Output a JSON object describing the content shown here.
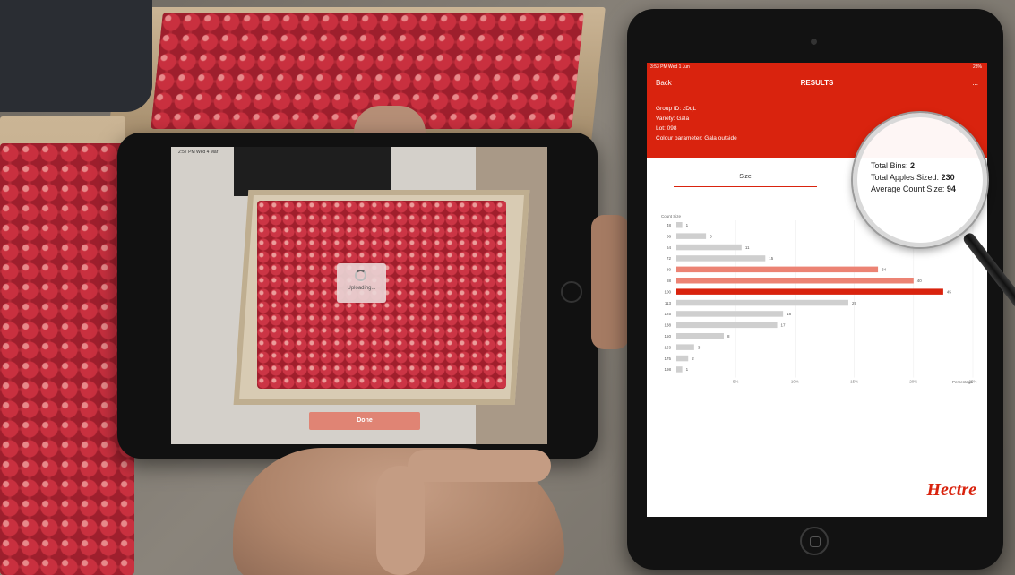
{
  "left_tablet": {
    "status_time": "2:57 PM   Wed 4 Mar",
    "uploading_label": "Uploading...",
    "done_label": "Done"
  },
  "right_tablet": {
    "status_left": "3:53 PM   Wed 1 Jun",
    "status_right": "23%",
    "header": {
      "back_label": "Back",
      "title": "RESULTS",
      "more_label": "..."
    },
    "info": {
      "group_id": "Group ID: zDqL",
      "variety": "Variety: Gala",
      "lot": "Lot: 098",
      "colour_parameter": "Colour parameter: Gala outside"
    },
    "tab_label": "Size",
    "summary": {
      "total_bins_label": "Total Bins:",
      "total_bins_value": "2",
      "total_apples_label": "Total Apples Sized:",
      "total_apples_value": "230",
      "avg_count_label": "Average Count Size:",
      "avg_count_value": "94"
    },
    "logo": "Hectre"
  },
  "colors": {
    "brand_red": "#d9230e",
    "bar_gray": "#cfcfcf",
    "bar_salmon": "#ec8374",
    "bar_red": "#d9230e"
  },
  "chart_data": {
    "type": "bar",
    "orientation": "horizontal",
    "ylabel": "Count Size",
    "xlabel": "Percentage",
    "categories": [
      "48",
      "56",
      "64",
      "72",
      "80",
      "88",
      "100",
      "113",
      "125",
      "138",
      "150",
      "163",
      "175",
      "198"
    ],
    "values": [
      1,
      5,
      11,
      15,
      34,
      40,
      45,
      29,
      18,
      17,
      8,
      3,
      2,
      1
    ],
    "bar_colors": [
      "gray",
      "gray",
      "gray",
      "gray",
      "salmon",
      "salmon",
      "red",
      "gray",
      "gray",
      "gray",
      "gray",
      "gray",
      "gray",
      "gray"
    ],
    "x_ticks": [
      "0%",
      "10%",
      "15%",
      "20%",
      "25%"
    ],
    "x_tick_prefix": "5%",
    "xlim": [
      0,
      50
    ],
    "grid": true
  }
}
